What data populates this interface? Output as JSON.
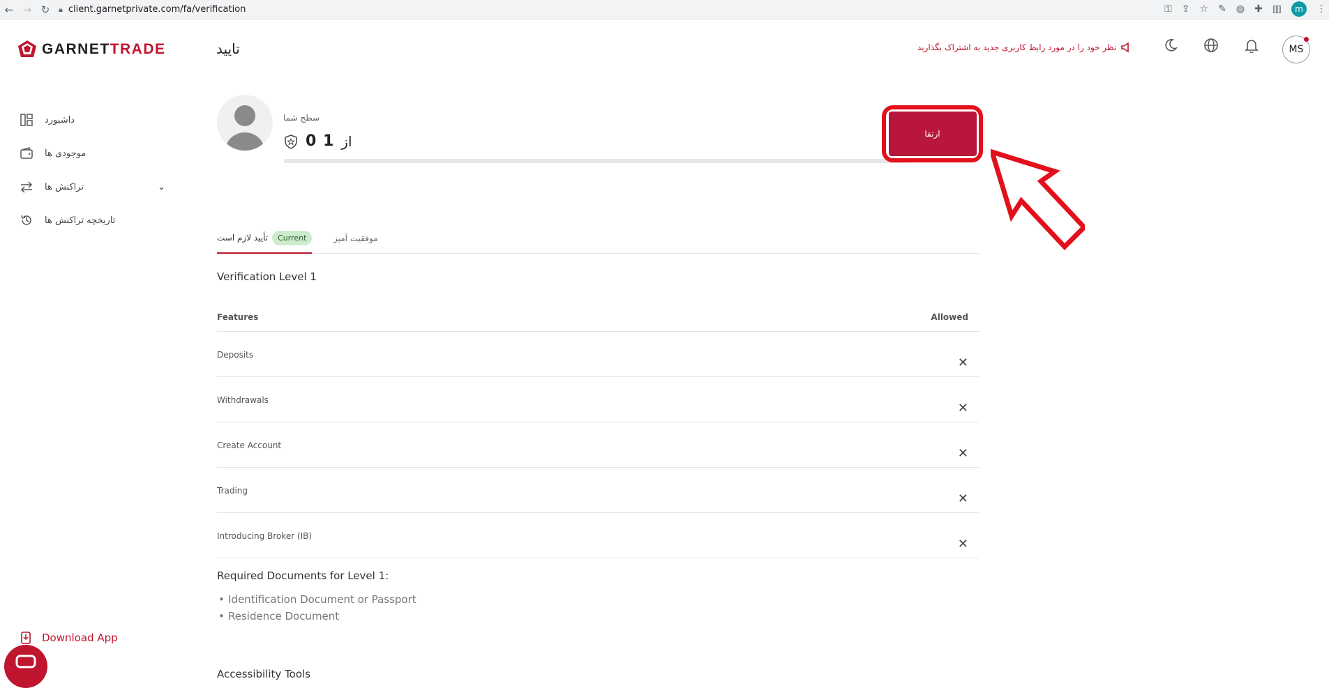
{
  "browser": {
    "url": "client.garnetprivate.com/fa/verification",
    "profile_initial": "m"
  },
  "brand": {
    "name_dark": "GARNET",
    "name_red": "TRADE"
  },
  "header": {
    "title": "تایید",
    "feedback": "نظر خود را در مورد رابط کاربری جدید به اشتراک بگذارید",
    "user_initials": "MS"
  },
  "sidebar": {
    "items": [
      {
        "label": "داشبورد",
        "icon": "dashboard-icon"
      },
      {
        "label": "موجودی ها",
        "icon": "wallet-icon"
      },
      {
        "label": "تراکنش ها",
        "icon": "transfer-icon"
      },
      {
        "label": "تاریخچه تراکنش ها",
        "icon": "history-icon"
      }
    ],
    "download": "Download App"
  },
  "level": {
    "label": "سطح شما",
    "current": "0",
    "max": "1",
    "of": "از",
    "progress_fraction": 0,
    "upgrade": "ارتقا"
  },
  "tabs": {
    "required": "تأیید لازم است",
    "current_badge": "Current",
    "success": "موفقیت آمیز"
  },
  "verification": {
    "heading": "Verification Level 1",
    "col_features": "Features",
    "col_allowed": "Allowed",
    "rows": [
      {
        "feature": "Deposits",
        "allowed": "✕"
      },
      {
        "feature": "Withdrawals",
        "allowed": "✕"
      },
      {
        "feature": "Create Account",
        "allowed": "✕"
      },
      {
        "feature": "Trading",
        "allowed": "✕"
      },
      {
        "feature": "Introducing Broker (IB)",
        "allowed": "✕"
      }
    ],
    "required_title": "Required Documents for Level 1:",
    "documents": [
      "Identification Document or Passport",
      "Residence Document"
    ],
    "cut_off": "Accessibility Tools"
  },
  "colors": {
    "accent": "#c0152f",
    "highlight": "#e3101c",
    "badge": "#cdeccd"
  }
}
